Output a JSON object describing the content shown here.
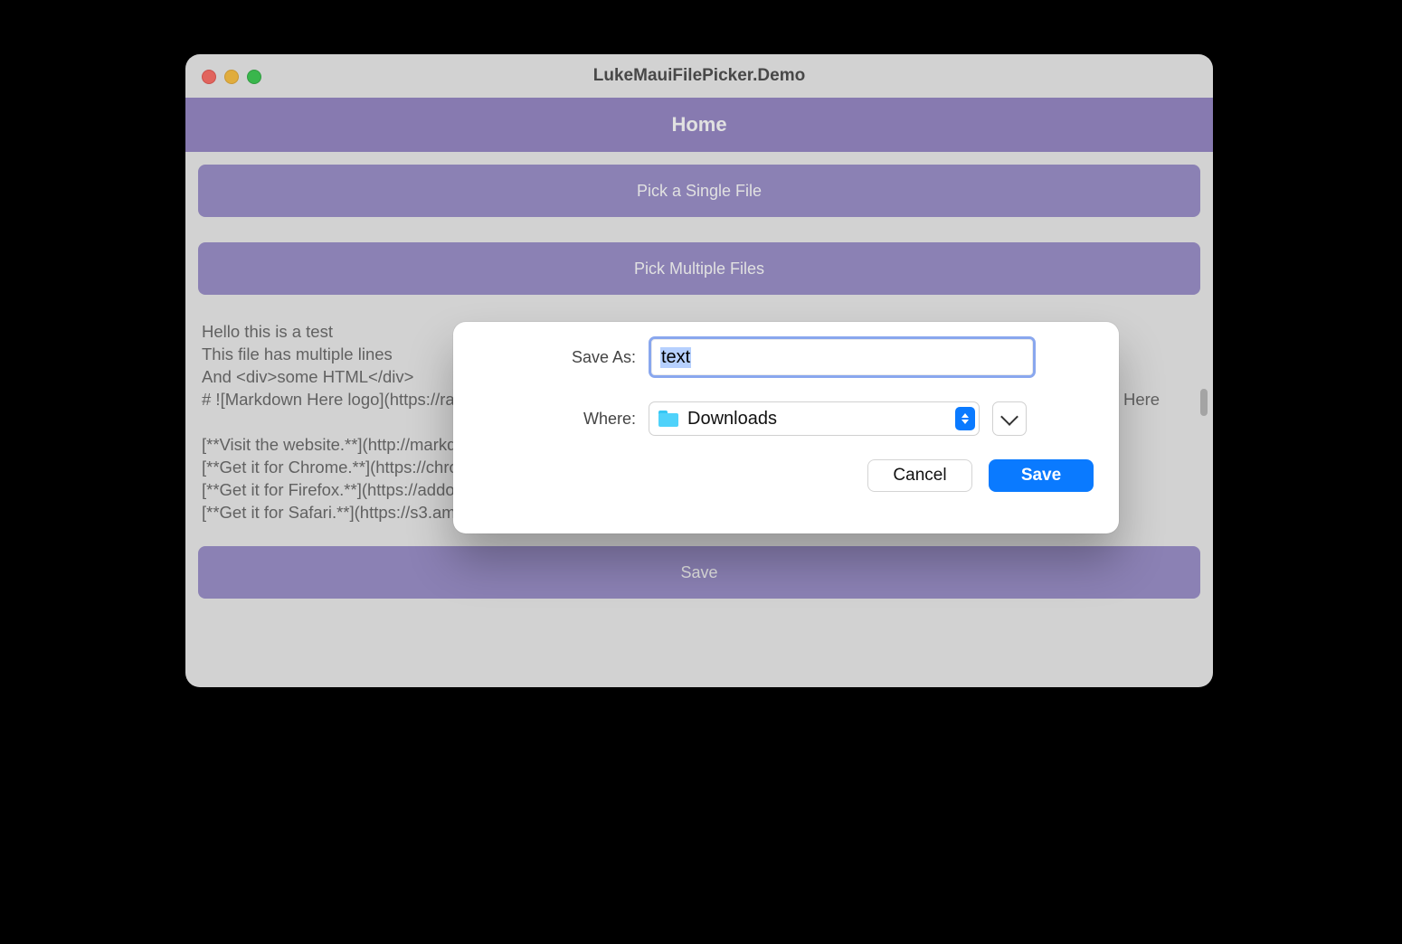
{
  "window": {
    "title": "LukeMauiFilePicker.Demo"
  },
  "header": {
    "title": "Home"
  },
  "buttons": {
    "pick_single": "Pick a Single File",
    "pick_multi": "Pick Multiple Files",
    "save": "Save"
  },
  "editor_text": "Hello this is a test\nThis file has multiple lines\nAnd <div>some HTML</div>\n# ![Markdown Here logo](https://raw.github.com/adam-p/markdown-here/master/src/common/images/icon48.png) Markdown Here\n\n[**Visit the website.**](http://markdown-here.com)<br>\n[**Get it for Chrome.**](https://chrome.google.com/webstore/detail/elifhakcjgalahccnjkneoccemfahfoa)<br>\n[**Get it for Firefox.**](https://addons.mozilla.org/en-US/firefox/addon/markdown-here/)<br>\n[**Get it for Safari.**](https://s3.amazonaws.com/markdown-here/markdown-here.safariextz)<br>",
  "save_dialog": {
    "save_as_label": "Save As:",
    "filename": "text",
    "where_label": "Where:",
    "folder": "Downloads",
    "cancel": "Cancel",
    "save": "Save"
  }
}
